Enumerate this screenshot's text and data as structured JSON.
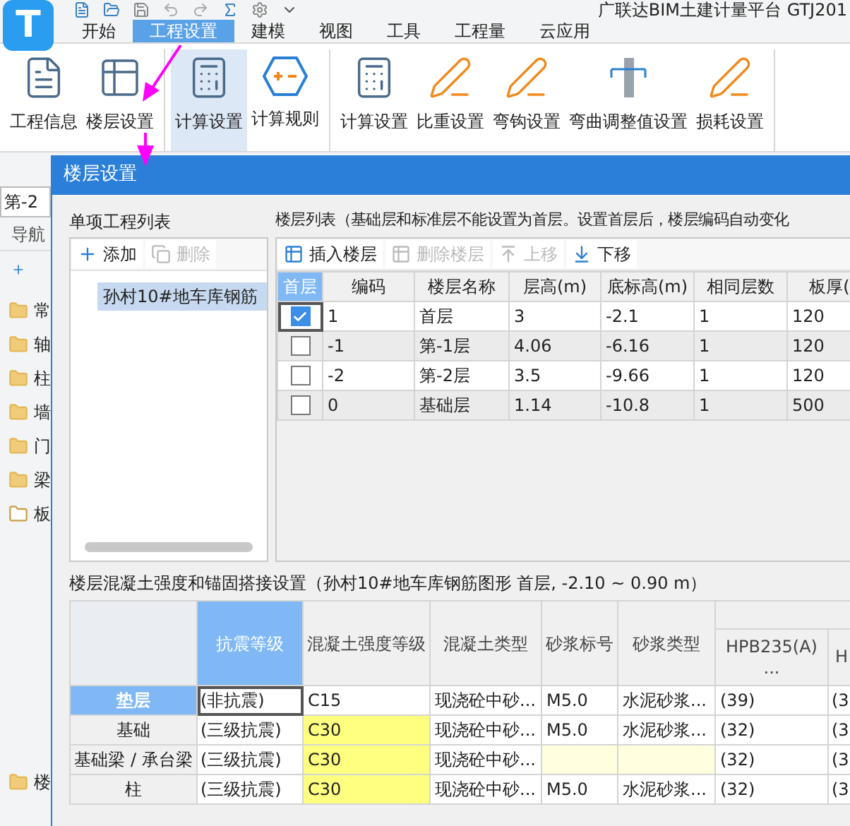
{
  "app": {
    "logo_letter": "T",
    "title": "广联达BIM土建计量平台 GTJ201"
  },
  "ribbon_tabs": [
    {
      "label": "开始",
      "selected": false
    },
    {
      "label": "工程设置",
      "selected": true
    },
    {
      "label": "建模",
      "selected": false
    },
    {
      "label": "视图",
      "selected": false
    },
    {
      "label": "工具",
      "selected": false
    },
    {
      "label": "工程量",
      "selected": false
    },
    {
      "label": "云应用",
      "selected": false
    }
  ],
  "ribbon_groups": [
    {
      "buttons": [
        {
          "label": "工程信息",
          "selected": false
        },
        {
          "label": "楼层设置",
          "selected": false
        }
      ]
    },
    {
      "buttons": [
        {
          "label": "计算设置",
          "selected": true
        },
        {
          "label": "计算规则",
          "selected": false
        }
      ]
    },
    {
      "buttons": [
        {
          "label": "计算设置",
          "selected": false
        },
        {
          "label": "比重设置",
          "selected": false
        },
        {
          "label": "弯钩设置",
          "selected": false
        },
        {
          "label": "弯曲调整值设置",
          "selected": false
        },
        {
          "label": "损耗设置",
          "selected": false
        }
      ]
    }
  ],
  "left_pane": {
    "floor_select": "第-2",
    "nav_title": "导航",
    "nav_items": [
      {
        "label": "常",
        "expanded": false
      },
      {
        "label": "轴",
        "expanded": false
      },
      {
        "label": "柱",
        "expanded": false
      },
      {
        "label": "墙",
        "expanded": false
      },
      {
        "label": "门",
        "expanded": false
      },
      {
        "label": "梁",
        "expanded": false
      },
      {
        "label": "板",
        "expanded": true
      }
    ],
    "bottom_items": [
      {
        "label": "楼",
        "expanded": false
      }
    ]
  },
  "dialog": {
    "title": "楼层设置",
    "project_list": {
      "title": "单项工程列表",
      "buttons": [
        {
          "label": "添加",
          "disabled": false
        },
        {
          "label": "删除",
          "disabled": true
        }
      ],
      "items": [
        {
          "label": "孙村10#地车库钢筋",
          "selected": true
        }
      ]
    },
    "floor_list": {
      "title": "楼层列表（基础层和标准层不能设置为首层。设置首层后，楼层编码自动变化",
      "toolbar": [
        {
          "label": "插入楼层",
          "disabled": false
        },
        {
          "label": "删除楼层",
          "disabled": true
        },
        {
          "label": "上移",
          "disabled": true
        },
        {
          "label": "下移",
          "disabled": false
        }
      ],
      "checkbox_column": {
        "label": "首层",
        "selected": true
      },
      "columns": [
        {
          "label": "编码",
          "selected": false
        },
        {
          "label": "楼层名称",
          "selected": false
        },
        {
          "label": "层高(m)",
          "selected": false
        },
        {
          "label": "底标高(m)",
          "selected": false
        },
        {
          "label": "相同层数",
          "selected": false
        },
        {
          "label": "板厚(",
          "selected": false
        }
      ],
      "rows": [
        {
          "checked": true,
          "selected": true,
          "cells": [
            "1",
            "首层",
            "3",
            "-2.1",
            "1",
            "120"
          ]
        },
        {
          "checked": false,
          "selected": false,
          "cells": [
            "-1",
            "第-1层",
            "4.06",
            "-6.16",
            "1",
            "120"
          ]
        },
        {
          "checked": false,
          "selected": false,
          "cells": [
            "-2",
            "第-2层",
            "3.5",
            "-9.66",
            "1",
            "120"
          ]
        },
        {
          "checked": false,
          "selected": false,
          "cells": [
            "0",
            "基础层",
            "1.14",
            "-10.8",
            "1",
            "500"
          ]
        }
      ]
    },
    "concrete_settings": {
      "title": "楼层混凝土强度和锚固搭接设置（孙村10#地车库钢筋图形  首层, -2.10 ~ 0.90 m）",
      "columns": [
        {
          "label": "抗震等级",
          "selected": true
        },
        {
          "label": "混凝土强度等级",
          "selected": false
        },
        {
          "label": "混凝土类型",
          "selected": false
        },
        {
          "label": "砂浆标号",
          "selected": false
        },
        {
          "label": "砂浆类型",
          "selected": false
        },
        {
          "label": "HPB235(A)\n...",
          "selected": false
        },
        {
          "label": "H",
          "selected": false
        }
      ],
      "rows": [
        {
          "name": "垫层",
          "selected": true,
          "seismic": "(非抗震)",
          "concrete": "C15",
          "concrete_highlighted": false,
          "concrete_type": "现浇砼中砂...",
          "mortar_grade": "M5.0",
          "mortar_type": "水泥砂浆...",
          "hpb235": "(39)",
          "column_8": "(3"
        },
        {
          "name": "基础",
          "selected": false,
          "seismic": "(三级抗震)",
          "concrete": "C30",
          "concrete_highlighted": true,
          "concrete_type": "现浇砼中砂...",
          "mortar_grade": "M5.0",
          "mortar_type": "水泥砂浆...",
          "hpb235": "(32)",
          "column_8": "(3"
        },
        {
          "name": "基础梁 / 承台梁",
          "selected": false,
          "seismic": "(三级抗震)",
          "concrete": "C30",
          "concrete_highlighted": true,
          "concrete_type": "现浇砼中砂...",
          "hpb235": "(32)",
          "column_8": "(3"
        },
        {
          "name": "柱",
          "selected": false,
          "seismic": "(三级抗震)",
          "concrete": "C30",
          "concrete_highlighted": true,
          "concrete_type": "现浇砼中砂...",
          "mortar_grade": "M5.0",
          "mortar_type": "水泥砂浆...",
          "hpb235": "(32)",
          "column_8": "(3"
        }
      ]
    }
  }
}
